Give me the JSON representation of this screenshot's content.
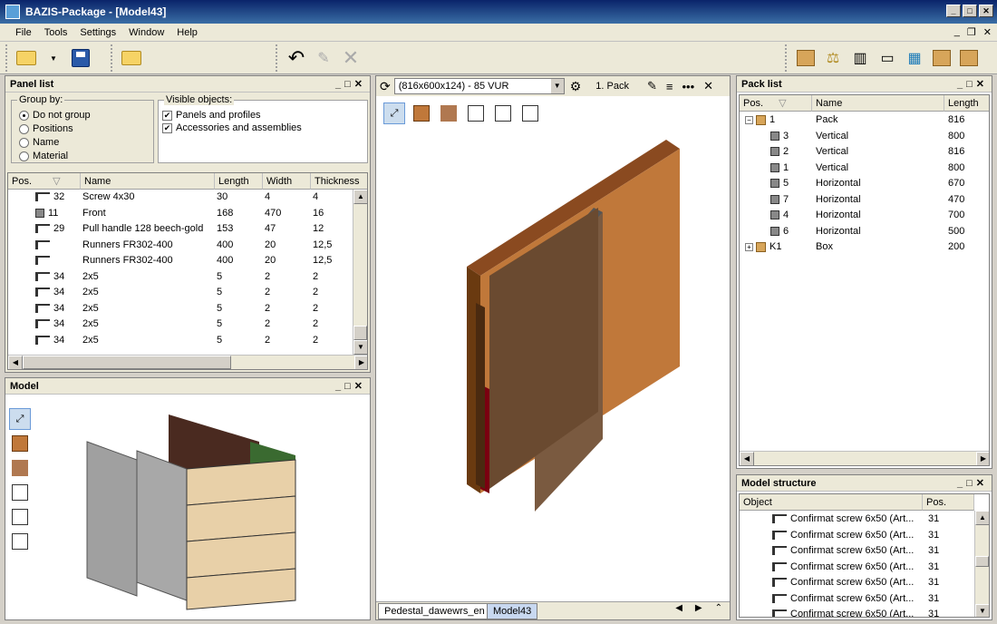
{
  "window": {
    "title": "BAZIS-Package - [Model43]"
  },
  "menu": [
    "File",
    "Tools",
    "Settings",
    "Window",
    "Help"
  ],
  "panel_list": {
    "title": "Panel list",
    "group_by": {
      "label": "Group by:",
      "options": [
        "Do not group",
        "Positions",
        "Name",
        "Material"
      ],
      "selected": "Do not group"
    },
    "visible_objects": {
      "label": "Visible objects:",
      "items": [
        {
          "label": "Panels and profiles",
          "checked": true
        },
        {
          "label": "Accessories and assemblies",
          "checked": true
        }
      ]
    },
    "columns": [
      "Pos.",
      "Name",
      "Length",
      "Width",
      "Thickness"
    ],
    "rows": [
      {
        "pos": "32",
        "name": "Screw 4x30",
        "length": "30",
        "width": "4",
        "thickness": "4",
        "icon": "screw-icon"
      },
      {
        "pos": "11",
        "name": "Front",
        "length": "168",
        "width": "470",
        "thickness": "16",
        "icon": "panel-icon"
      },
      {
        "pos": "29",
        "name": "Pull handle 128 beech-gold",
        "length": "153",
        "width": "47",
        "thickness": "12",
        "icon": "screw-icon"
      },
      {
        "pos": "",
        "name": "Runners FR302-400",
        "length": "400",
        "width": "20",
        "thickness": "12,5",
        "icon": "screw-icon"
      },
      {
        "pos": "",
        "name": "Runners FR302-400",
        "length": "400",
        "width": "20",
        "thickness": "12,5",
        "icon": "screw-icon"
      },
      {
        "pos": "34",
        "name": "2x5",
        "length": "5",
        "width": "2",
        "thickness": "2",
        "icon": "screw-icon"
      },
      {
        "pos": "34",
        "name": "2x5",
        "length": "5",
        "width": "2",
        "thickness": "2",
        "icon": "screw-icon"
      },
      {
        "pos": "34",
        "name": "2x5",
        "length": "5",
        "width": "2",
        "thickness": "2",
        "icon": "screw-icon"
      },
      {
        "pos": "34",
        "name": "2x5",
        "length": "5",
        "width": "2",
        "thickness": "2",
        "icon": "screw-icon"
      },
      {
        "pos": "34",
        "name": "2x5",
        "length": "5",
        "width": "2",
        "thickness": "2",
        "icon": "screw-icon"
      }
    ]
  },
  "model_panel": {
    "title": "Model"
  },
  "center": {
    "pack_select": "(816x600x124) - 85 VUR",
    "pack_label": "1. Pack",
    "tabs": [
      "Pedestal_dawewrs_en",
      "Model43"
    ]
  },
  "pack_list": {
    "title": "Pack list",
    "columns": [
      "Pos.",
      "Name",
      "Length"
    ],
    "rows": [
      {
        "pos": "1",
        "name": "Pack",
        "length": "816",
        "level": 0,
        "expander": "−",
        "icon": "pack-icon"
      },
      {
        "pos": "3",
        "name": "Vertical",
        "length": "800",
        "level": 1,
        "expander": "",
        "icon": "panel-icon"
      },
      {
        "pos": "2",
        "name": "Vertical",
        "length": "816",
        "level": 1,
        "expander": "",
        "icon": "panel-icon"
      },
      {
        "pos": "1",
        "name": "Vertical",
        "length": "800",
        "level": 1,
        "expander": "",
        "icon": "panel-icon"
      },
      {
        "pos": "5",
        "name": "Horizontal",
        "length": "670",
        "level": 1,
        "expander": "",
        "icon": "panel-icon"
      },
      {
        "pos": "7",
        "name": "Horizontal",
        "length": "470",
        "level": 1,
        "expander": "",
        "icon": "panel-icon"
      },
      {
        "pos": "4",
        "name": "Horizontal",
        "length": "700",
        "level": 1,
        "expander": "",
        "icon": "panel-icon"
      },
      {
        "pos": "6",
        "name": "Horizontal",
        "length": "500",
        "level": 1,
        "expander": "",
        "icon": "panel-icon"
      },
      {
        "pos": "K1",
        "name": "Box",
        "length": "200",
        "level": 0,
        "expander": "+",
        "icon": "pack-icon"
      }
    ]
  },
  "model_structure": {
    "title": "Model structure",
    "columns": [
      "Object",
      "Pos."
    ],
    "rows": [
      {
        "object": "Confirmat screw 6x50 (Art...",
        "pos": "31"
      },
      {
        "object": "Confirmat screw 6x50 (Art...",
        "pos": "31"
      },
      {
        "object": "Confirmat screw 6x50 (Art...",
        "pos": "31"
      },
      {
        "object": "Confirmat screw 6x50 (Art...",
        "pos": "31"
      },
      {
        "object": "Confirmat screw 6x50 (Art...",
        "pos": "31"
      },
      {
        "object": "Confirmat screw 6x50 (Art...",
        "pos": "31"
      },
      {
        "object": "Confirmat screw 6x50 (Art...",
        "pos": "31"
      }
    ]
  }
}
